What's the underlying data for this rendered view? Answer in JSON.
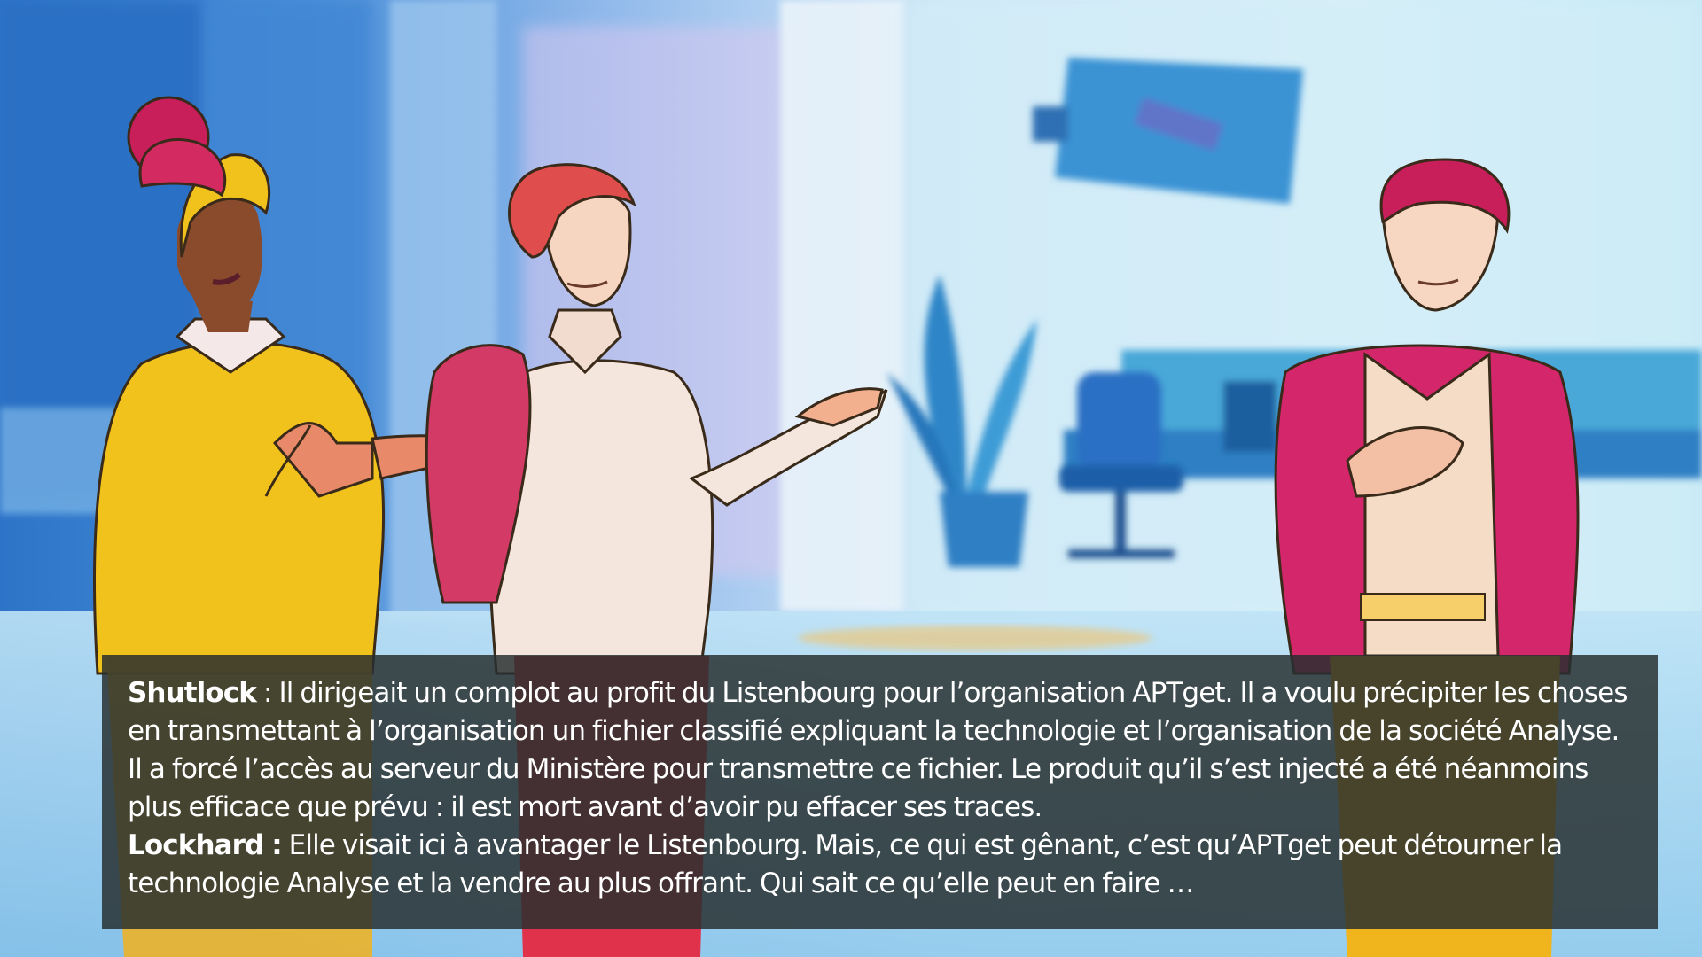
{
  "dialogue": {
    "lines": [
      {
        "speaker": "Shutlock",
        "separator": " : ",
        "text": "Il dirigeait un complot au profit du Listenbourg pour l’organisation APTget. Il a voulu précipiter les choses en transmettant à l’organisation un fichier classifié expliquant la technologie et l’organisation de la société Analyse. Il a forcé l’accès au serveur du Ministère pour transmettre ce fichier. Le produit qu’il s’est injecté a été néanmoins plus efficace que prévu : il est mort avant d’avoir pu effacer ses traces."
      },
      {
        "speaker": "Lockhard :",
        "separator": " ",
        "text": "Elle visait ici à avantager le Listenbourg. Mais, ce qui est gênant, c’est qu’APTget peut détourner la technologie Analyse et la vendre au plus offrant. Qui sait ce qu’elle peut en faire …"
      }
    ]
  },
  "colors": {
    "panel": "#262e2e",
    "text": "#ffffff",
    "sky": "#bfe6f5",
    "wall_blue": "#2f7fd0",
    "yellow_sweater": "#f2c21c",
    "magenta_jacket": "#d4266b",
    "red_hair": "#e04d4d"
  },
  "icons": [
    "illustrated-office-background",
    "character-woman-yellow-sweater",
    "character-red-haired-person",
    "character-man-magenta-jacket",
    "wall-screen-icon",
    "potted-plant-icon",
    "office-chair-icon"
  ]
}
